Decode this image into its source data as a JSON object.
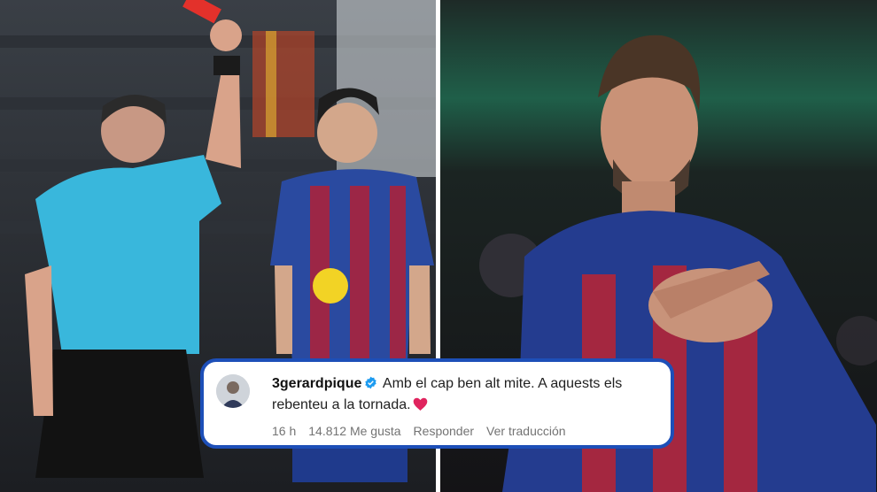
{
  "left_photo": {
    "icon": "red-card-photo"
  },
  "right_photo": {
    "icon": "player-photo"
  },
  "comment": {
    "username": "3gerardpique",
    "text": "Amb el cap ben alt mite. A aquests els rebenteu a la tornada.",
    "verified_icon": "verified-badge-icon",
    "heart_icon": "heart-icon",
    "time": "16 h",
    "likes": "14.812 Me gusta",
    "reply": "Responder",
    "translate": "Ver traducción"
  },
  "colors": {
    "card_border": "#1d4fb8",
    "verified": "#1d9bf0",
    "heart": "#e0245e"
  }
}
